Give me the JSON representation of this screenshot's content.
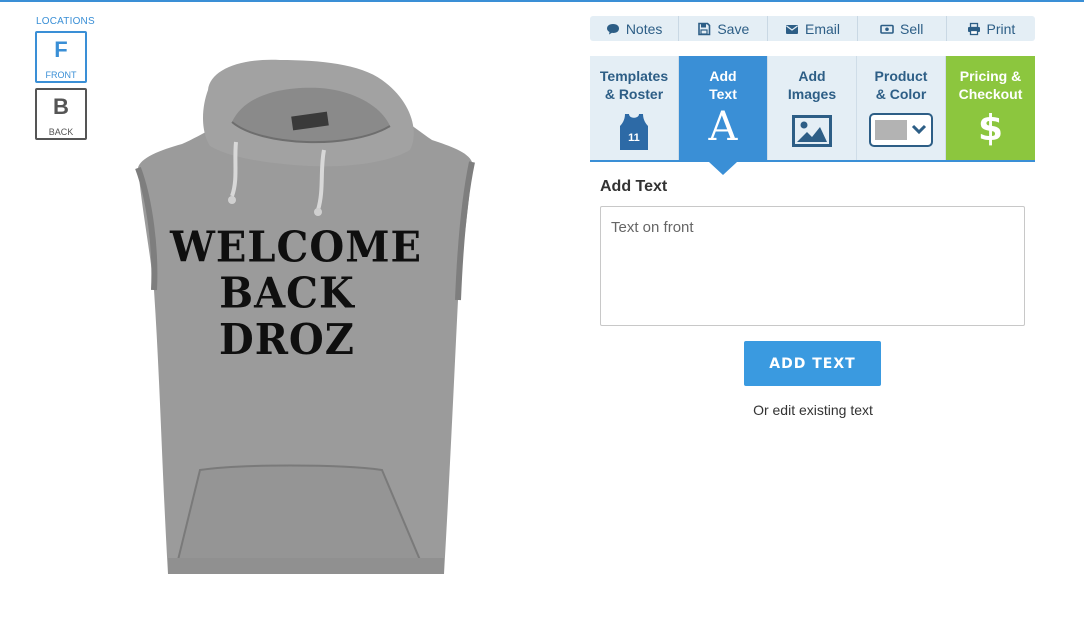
{
  "locations": {
    "title": "LOCATIONS",
    "front": {
      "letter": "F",
      "label": "FRONT"
    },
    "back": {
      "letter": "B",
      "label": "BACK"
    }
  },
  "garment": {
    "design_lines": [
      "WELCOME",
      "BACK",
      "DROZ"
    ],
    "color": "#9a9a9a"
  },
  "toolbar": {
    "notes": "Notes",
    "save": "Save",
    "email": "Email",
    "sell": "Sell",
    "print": "Print"
  },
  "tabs": {
    "templates": "Templates\n& Roster",
    "jersey_number": "11",
    "add_text": "Add\nText",
    "add_text_icon": "A",
    "add_images": "Add\nImages",
    "product_color": "Product\n& Color",
    "pricing": "Pricing &\nCheckout",
    "pricing_icon": "$"
  },
  "panel": {
    "title": "Add Text",
    "textarea_placeholder": "Text on front",
    "button": "ADD TEXT",
    "edit_link": "Or edit existing text"
  },
  "colors": {
    "accent": "#3a8fd6",
    "pricing": "#8cc63e",
    "toolbar_bg": "#e4eef5",
    "tab_text": "#2d5e86"
  }
}
